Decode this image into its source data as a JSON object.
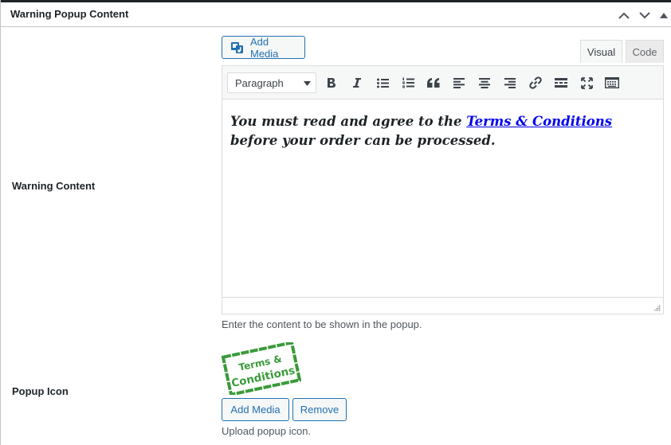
{
  "panel": {
    "title": "Warning Popup Content"
  },
  "warning_content": {
    "label": "Warning Content",
    "add_media_label": "Add Media",
    "tabs": {
      "visual": "Visual",
      "code": "Code"
    },
    "format_select": "Paragraph",
    "content": {
      "before": "You must read and agree to the ",
      "link_text": "Terms & Conditions",
      "after": " before your order can be processed."
    },
    "description": "Enter the content to be shown in the popup."
  },
  "popup_icon": {
    "label": "Popup Icon",
    "stamp_line1": "Terms &",
    "stamp_line2": "Conditions",
    "add_media_label": "Add Media",
    "remove_label": "Remove",
    "description": "Upload popup icon."
  },
  "colors": {
    "accent": "#2271b1",
    "stamp_green": "#3a9a3a",
    "link": "#0000ee"
  },
  "icons": [
    "chevron-up-icon",
    "chevron-down-icon",
    "triangle-up-icon",
    "add-media-icon",
    "bold-icon",
    "italic-icon",
    "bullet-list-icon",
    "numbered-list-icon",
    "blockquote-icon",
    "align-left-icon",
    "align-center-icon",
    "align-right-icon",
    "link-icon",
    "read-more-icon",
    "fullscreen-icon",
    "toolbar-toggle-icon",
    "resize-handle-icon"
  ]
}
